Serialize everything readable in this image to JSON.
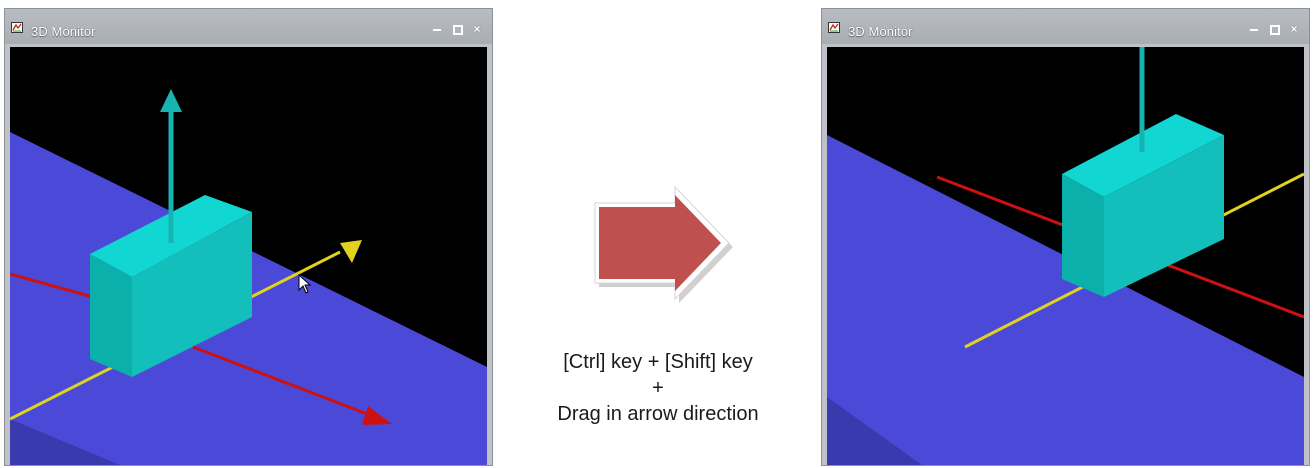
{
  "windows": [
    {
      "title": "3D Monitor",
      "state": "before"
    },
    {
      "title": "3D Monitor",
      "state": "after"
    }
  ],
  "window_controls": {
    "minimize": "–",
    "maximize": "□",
    "close": "×"
  },
  "instructions": {
    "line1": "[Ctrl] key + [Shift] key",
    "line2": "+",
    "line3": "Drag in arrow direction"
  },
  "icons": {
    "app": "3d-monitor-app-icon",
    "transition": "arrow-right-icon",
    "pointer": "mouse-cursor-icon"
  },
  "colors": {
    "ground": "#4b4ad8",
    "box_front": "#0fb8b2",
    "box_top": "#11d6d2",
    "y_axis": "#e0d21e",
    "x_axis": "#cc1111",
    "z_axis": "#16b4b0",
    "background": "#000000",
    "transition_arrow": "#c0504d"
  }
}
